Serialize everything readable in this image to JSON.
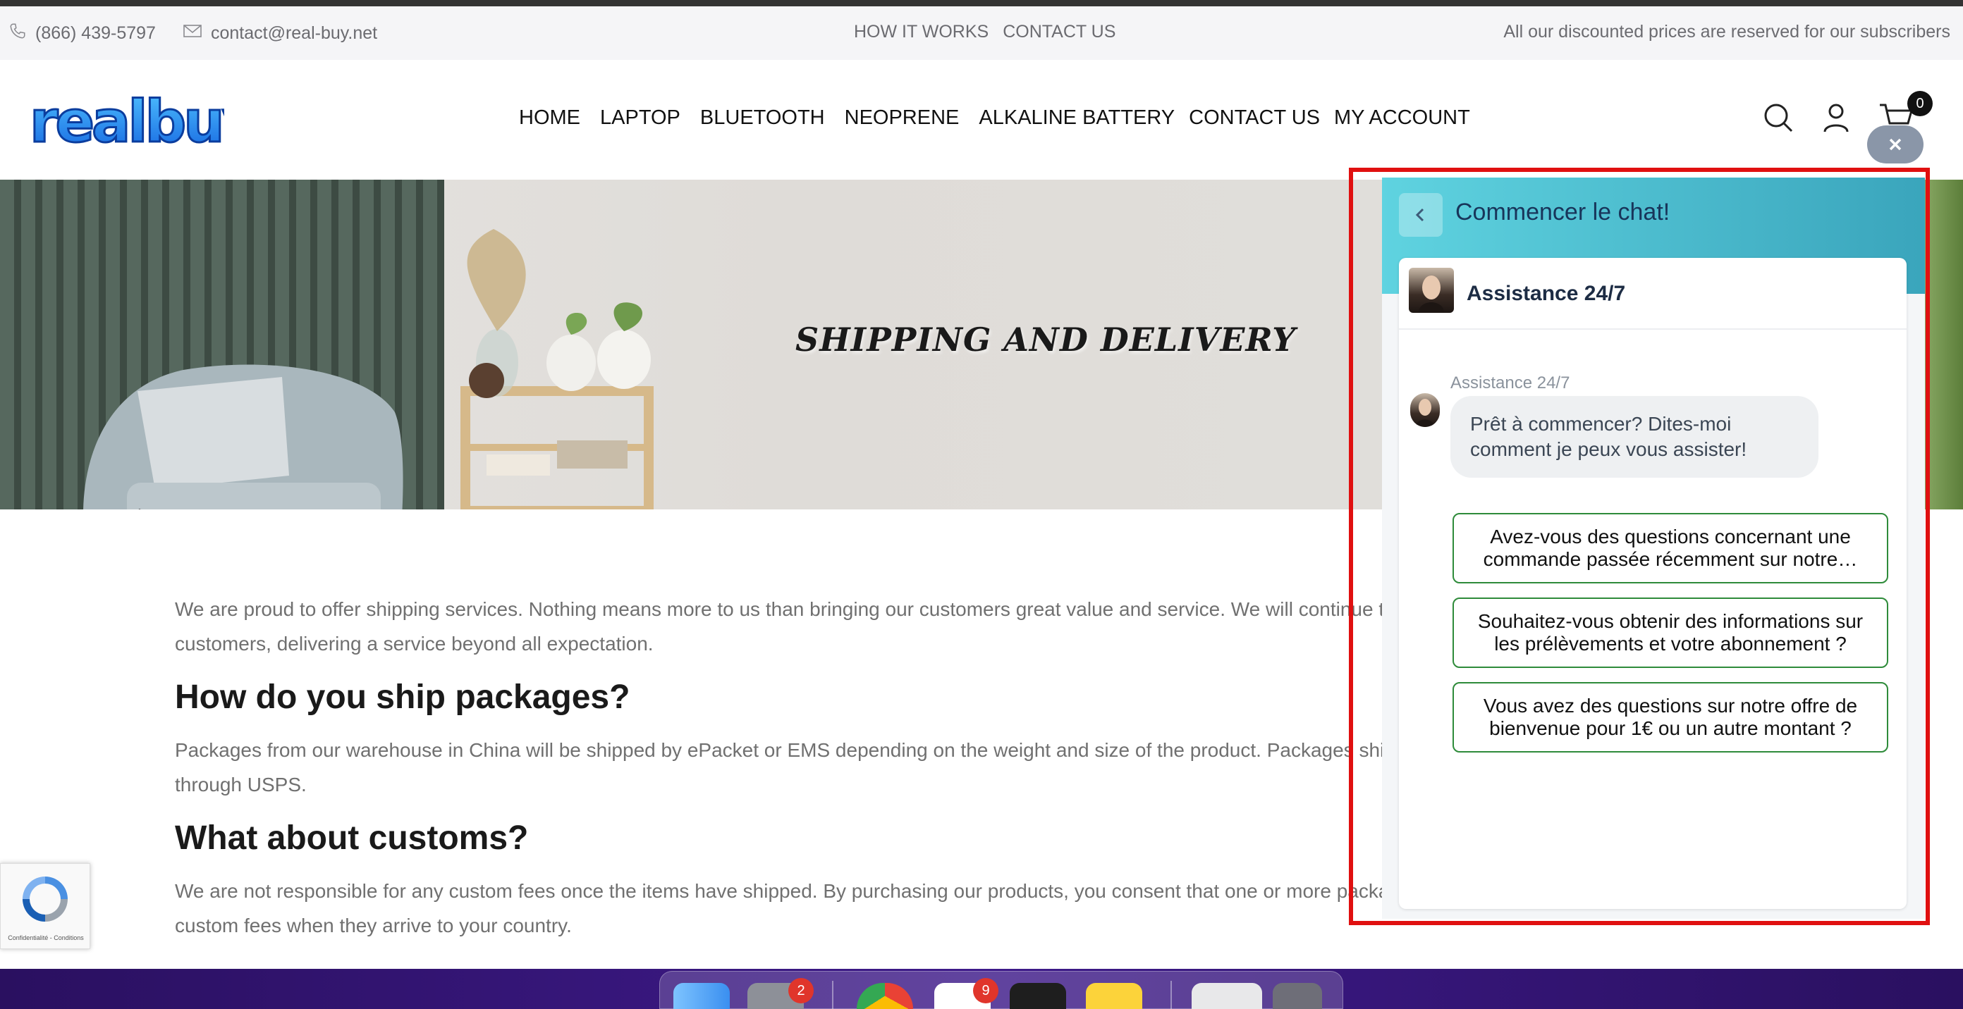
{
  "utility_bar": {
    "phone": "(866) 439-5797",
    "email": "contact@real-buy.net",
    "links": [
      "HOW IT WORKS",
      "CONTACT US"
    ],
    "notice": "All our discounted prices are reserved for our subscribers"
  },
  "header": {
    "logo_text": "realbuy",
    "nav": [
      "HOME",
      "LAPTOP",
      "BLUETOOTH",
      "NEOPRENE",
      "ALKALINE BATTERY",
      "CONTACT US",
      "MY ACCOUNT"
    ],
    "cart_count": "0",
    "icons": [
      "search-icon",
      "user-icon",
      "cart-icon",
      "close-icon"
    ]
  },
  "hero": {
    "title": "SHIPPING AND DELIVERY"
  },
  "content": {
    "intro": "We are proud to offer shipping services. Nothing means more to us than bringing our customers great value and service. We will continue t",
    "intro_cont": "customers, delivering a service beyond all expectation.",
    "h1": "How do you ship packages?",
    "p1": "Packages from our warehouse in China will be shipped by ePacket or EMS depending on the weight and size of the product. Packages shi",
    "p1_cont": "through USPS.",
    "h2": "What about customs?",
    "p2": "We are not responsible for any custom fees once the items have shipped. By purchasing our products, you consent that one or more packages may be shipped to you and may get",
    "p2_cont": "custom fees when they arrive to your country."
  },
  "recaptcha": {
    "label": "Confidentialité - Conditions"
  },
  "chat": {
    "header_title": "Commencer le chat!",
    "agent_name": "Assistance 24/7",
    "sender_label": "Assistance 24/7",
    "message": "Prêt à commencer? Dites-moi comment je peux vous assister!",
    "options": [
      "Avez-vous des questions concernant une commande passée récemment sur notre…",
      "Souhaitez-vous obtenir des informations sur les prélèvements et votre abonnement ?",
      "Vous avez des questions sur notre offre de bienvenue pour 1€ ou un autre montant ?"
    ]
  },
  "dock": {
    "badges": [
      "2",
      "9"
    ]
  },
  "colors": {
    "highlight": "#e01010",
    "chat_header_start": "#5fd3e0",
    "chat_header_end": "#3aa5bc",
    "option_border": "#2e8b3a",
    "logo_blue": "#1e8ff0"
  }
}
